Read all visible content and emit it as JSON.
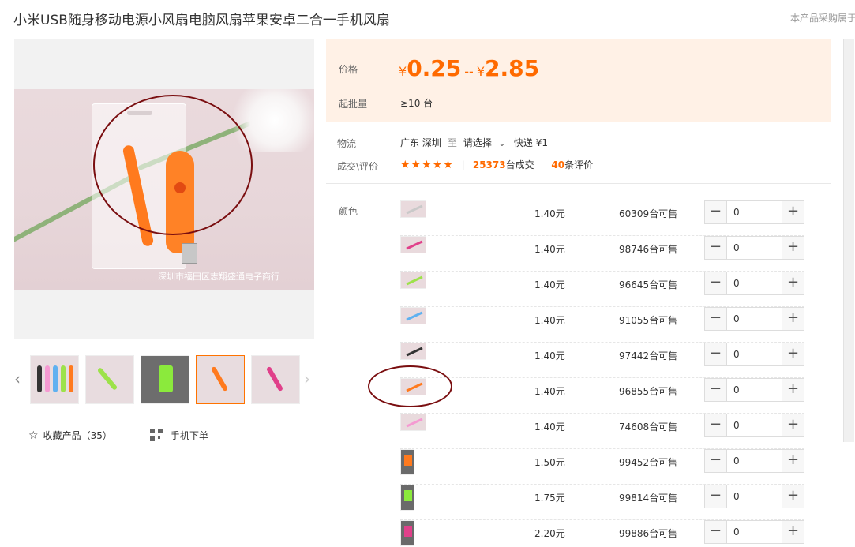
{
  "product": {
    "title": "小米USB随身移动电源小风扇电脑风扇苹果安卓二合一手机风扇",
    "note": "本产品采购属于",
    "watermark": "深圳市福田区志翔盛通电子商行"
  },
  "gallery": {
    "prev_icon": "chevron-left-icon",
    "next_icon": "chevron-right-icon",
    "thumbnail_count": 5,
    "selected_thumbnail": 4,
    "favorite_label": "收藏产品（35）",
    "mobile_label": "手机下单"
  },
  "price": {
    "label": "价格",
    "currency": "¥",
    "low": "0.25",
    "separator": "--",
    "high": "2.85",
    "moq_label": "起批量",
    "moq_value": "≥10 台"
  },
  "logistics": {
    "label": "物流",
    "from": "广东 深圳",
    "to_word": "至",
    "select_placeholder": "请选择",
    "express": "快递 ¥1"
  },
  "deals": {
    "label": "成交\\评价",
    "stars": "★★★★★",
    "count": "25373",
    "count_suffix": "台成交",
    "reviews": "40",
    "reviews_suffix": "条评价"
  },
  "sku": {
    "label": "颜色",
    "rows": [
      {
        "price": "1.40元",
        "stock": "60309台可售",
        "qty": "0"
      },
      {
        "price": "1.40元",
        "stock": "98746台可售",
        "qty": "0"
      },
      {
        "price": "1.40元",
        "stock": "96645台可售",
        "qty": "0"
      },
      {
        "price": "1.40元",
        "stock": "91055台可售",
        "qty": "0"
      },
      {
        "price": "1.40元",
        "stock": "97442台可售",
        "qty": "0"
      },
      {
        "price": "1.40元",
        "stock": "96855台可售",
        "qty": "0"
      },
      {
        "price": "1.40元",
        "stock": "74608台可售",
        "qty": "0"
      },
      {
        "price": "1.50元",
        "stock": "99452台可售",
        "qty": "0"
      },
      {
        "price": "1.75元",
        "stock": "99814台可售",
        "qty": "0"
      },
      {
        "price": "2.20元",
        "stock": "99886台可售",
        "qty": "0"
      }
    ],
    "minus": "−",
    "plus": "+"
  },
  "colors": {
    "accent": "#ff6a00",
    "price_bg": "#fff1e6",
    "annotation": "#7a0e10"
  }
}
